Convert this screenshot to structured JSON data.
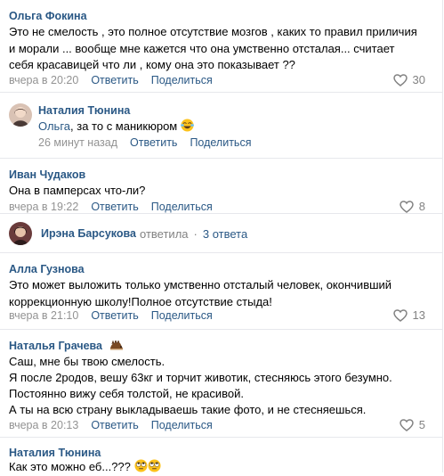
{
  "actions": {
    "reply": "Ответить",
    "share": "Поделиться"
  },
  "comments": [
    {
      "author": "Ольга Фокина",
      "text": "Это не смелость , это полное отсутствие мозгов , каких то правил приличия и морали ... вообще мне кажется что она умственно отсталая... считает себя красавицей что ли , кому она это показывает ??",
      "time": "вчера в 20:20",
      "likes": "30"
    },
    {
      "author": "Иван Чудаков",
      "text": "Она в памперсах что-ли?",
      "time": "вчера в 19:22",
      "likes": "8"
    },
    {
      "author": "Алла Гузнова",
      "text": "Это может выложить только умственно отсталый человек, окончивший коррекционную школу!Полное отсутствие стыда!",
      "time": "вчера в 21:10",
      "likes": "13"
    },
    {
      "author": "Наталья Грачева",
      "text": "Саш, мне бы твою смелость.",
      "text2": "Я после 2родов, вешу 63кг и торчит животик, стесняюсь этого безумно.",
      "text3": "Постоянно вижу себя толстой, не красивой.",
      "text4": "А ты на всю страну выкладываешь такие фото, и не стесняешься.",
      "time": "вчера в 20:13",
      "likes": "5"
    },
    {
      "author": "Наталия Тюнина",
      "text": "Как это можно еб...???"
    }
  ],
  "reply": {
    "author": "Наталия Тюнина",
    "addressee": "Ольга",
    "text": ", за то с маникюром",
    "time": "26 минут назад"
  },
  "thread": {
    "author": "Ирэна Барсукова",
    "verb": "ответила",
    "count": "3 ответа"
  },
  "colors": {
    "link": "#2a5885",
    "meta": "#939393",
    "divider": "#e7e8ec"
  },
  "icons": {
    "like": "heart-icon",
    "laugh": "tears-of-joy-emoji",
    "roll": "eye-roll-emoji",
    "badge": "hedgehog-icon"
  }
}
